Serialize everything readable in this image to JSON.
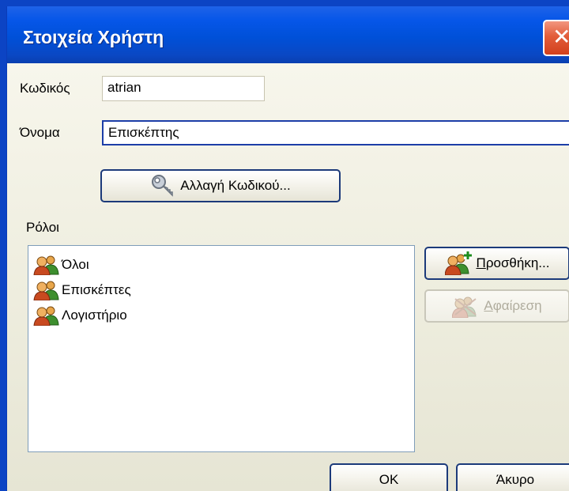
{
  "window": {
    "title": "Στοιχεία Χρήστη",
    "close_glyph": "✕"
  },
  "form": {
    "code_label": "Κωδικός",
    "code_value": "atrian",
    "name_label": "Όνομα",
    "name_value": "Επισκέπτης",
    "change_password_label": "Αλλαγή Κωδικού...",
    "change_password_icon": "key-icon"
  },
  "roles": {
    "label": "Ρόλοι",
    "items": [
      {
        "label": "Όλοι",
        "icon": "user-group-icon"
      },
      {
        "label": "Επισκέπτες",
        "icon": "user-group-icon"
      },
      {
        "label": "Λογιστήριο",
        "icon": "user-group-icon"
      }
    ],
    "add_label": "Προσθήκη...",
    "add_icon": "add-group-icon",
    "add_enabled": true,
    "remove_label": "Αφαίρεση",
    "remove_icon": "remove-group-icon",
    "remove_enabled": false
  },
  "footer": {
    "ok_label": "OK",
    "cancel_label": "Άκυρο"
  },
  "colors": {
    "titlebar": "#0a50d8",
    "close_button": "#e25d3a",
    "dialog_background": "#f0efe4",
    "button_border": "#1c3a7a",
    "focused_field_border": "#1c3ea8"
  }
}
